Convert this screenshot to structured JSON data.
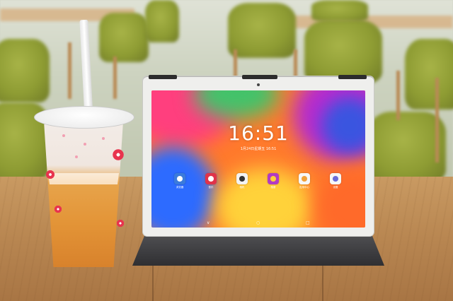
{
  "screen": {
    "clock": "16:51",
    "date": "1月24日星期五 16:51"
  },
  "apps": [
    {
      "label": "浏览器",
      "icon": "browser-icon",
      "color": "#3b7bdc",
      "inner": "#ffffff"
    },
    {
      "label": "音乐",
      "icon": "music-icon",
      "color": "#e0334a",
      "inner": "#ffffff"
    },
    {
      "label": "相机",
      "icon": "camera-icon",
      "color": "#f3f3f3",
      "inner": "#333333"
    },
    {
      "label": "相册",
      "icon": "gallery-icon",
      "color": "#b23bc4",
      "inner": "#ffcf3a"
    },
    {
      "label": "应用中心",
      "icon": "app-store-icon",
      "color": "#f7f7f7",
      "inner": "#f0a13a"
    },
    {
      "label": "设置",
      "icon": "settings-icon",
      "color": "#f7f7f7",
      "inner": "#6b6bd8"
    }
  ],
  "nav": {
    "back": "∨",
    "home": "○",
    "recents": "□"
  }
}
